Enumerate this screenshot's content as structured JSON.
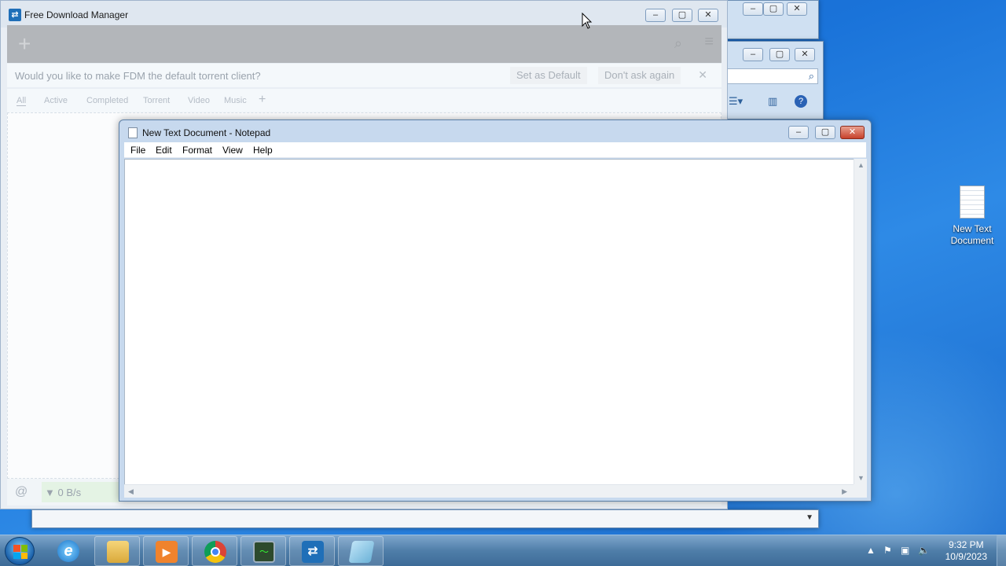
{
  "fdm": {
    "title": "Free Download Manager",
    "banner_question": "Would you like to make FDM the default torrent client?",
    "set_default": "Set as Default",
    "dont_ask": "Don't ask again",
    "tabs": [
      "All",
      "Active",
      "Completed",
      "Torrent",
      "Video",
      "Music"
    ],
    "speed": "0 B/s"
  },
  "notepad": {
    "title": "New Text Document - Notepad",
    "menu": [
      "File",
      "Edit",
      "Format",
      "View",
      "Help"
    ]
  },
  "desktop_icon": {
    "line1": "New Text",
    "line2": "Document"
  },
  "taskbar": {
    "apps": [
      "ie-icon",
      "explorer-icon",
      "media-player-icon",
      "chrome-icon",
      "task-manager-icon",
      "fdm-icon",
      "notepad-icon"
    ],
    "time": "9:32 PM",
    "date": "10/9/2023"
  },
  "colors": {
    "fdm_accent": "#1f6fb8",
    "taskbar": "#4f7ea9"
  }
}
